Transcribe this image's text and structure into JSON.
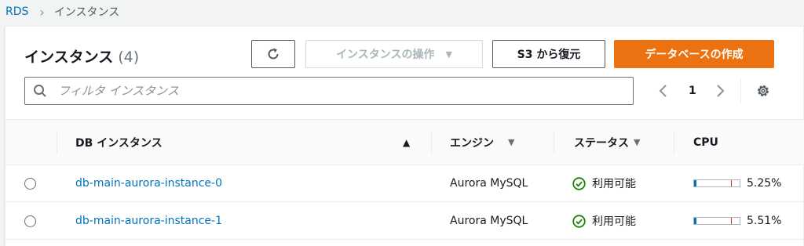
{
  "breadcrumb": {
    "root": "RDS",
    "current": "インスタンス"
  },
  "panel": {
    "title": "インスタンス",
    "count": "(4)"
  },
  "toolbar": {
    "actions_label": "インスタンスの操作",
    "restore_label": "S3 から復元",
    "create_label": "データベースの作成"
  },
  "search": {
    "placeholder": "フィルタ インスタンス",
    "value": ""
  },
  "pagination": {
    "page": "1"
  },
  "table": {
    "headers": {
      "name": "DB インスタンス",
      "engine": "エンジン",
      "status": "ステータス",
      "cpu": "CPU"
    },
    "rows": [
      {
        "name": "db-main-aurora-instance-0",
        "engine": "Aurora MySQL",
        "status": "利用可能",
        "cpu": "5.25%",
        "cpu_fraction": 0.0525
      },
      {
        "name": "db-main-aurora-instance-1",
        "engine": "Aurora MySQL",
        "status": "利用可能",
        "cpu": "5.51%",
        "cpu_fraction": 0.0551
      }
    ]
  },
  "colors": {
    "accent": "#ec7211",
    "link": "#0073bb",
    "success": "#1d8102",
    "threshold": "#d13212"
  }
}
